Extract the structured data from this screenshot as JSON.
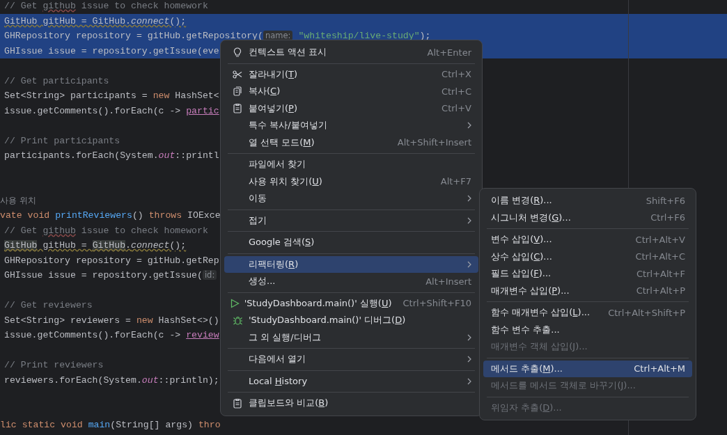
{
  "editor": {
    "lines": [
      {
        "kind": "body",
        "selected": false,
        "segments": [
          {
            "text": "// Get ",
            "kind": "comment"
          },
          {
            "text": "github",
            "kind": "typo"
          },
          {
            "text": " issue to check homework",
            "kind": "comment"
          }
        ]
      },
      {
        "kind": "body",
        "selected": true,
        "segments": [
          {
            "text": "GitHub gitHub = GitHub.",
            "kind": "warning"
          },
          {
            "text": "connect",
            "kind": "warning-italic"
          },
          {
            "text": "();",
            "kind": "warning"
          }
        ]
      },
      {
        "kind": "body",
        "selected": true,
        "segments": [
          {
            "text": "GHRepository repository = gitHub.getRepository(",
            "kind": "plain"
          },
          {
            "text": "name:",
            "kind": "hint"
          },
          {
            "text": "\"whiteship/live-study\"",
            "kind": "string"
          },
          {
            "text": ");",
            "kind": "plain"
          }
        ]
      },
      {
        "kind": "body",
        "selected": true,
        "segments": [
          {
            "text": "GHIssue issue = repository.getIssue(eve",
            "kind": "plain"
          }
        ]
      },
      {
        "kind": "blank",
        "selected": false
      },
      {
        "kind": "body",
        "selected": false,
        "segments": [
          {
            "text": "// Get participants",
            "kind": "comment"
          }
        ]
      },
      {
        "kind": "body",
        "selected": false,
        "segments": [
          {
            "text": "Set<String> participants = ",
            "kind": "plain"
          },
          {
            "text": "new",
            "kind": "keyword"
          },
          {
            "text": " HashSet<",
            "kind": "plain"
          }
        ]
      },
      {
        "kind": "body",
        "selected": false,
        "segments": [
          {
            "text": "issue.getComments().forEach(c -> ",
            "kind": "plain"
          },
          {
            "text": "partic",
            "kind": "field-underline"
          }
        ]
      },
      {
        "kind": "blank",
        "selected": false
      },
      {
        "kind": "body",
        "selected": false,
        "segments": [
          {
            "text": "// Print participants",
            "kind": "comment"
          }
        ]
      },
      {
        "kind": "body",
        "selected": false,
        "segments": [
          {
            "text": "participants.forEach(System.",
            "kind": "plain"
          },
          {
            "text": "out",
            "kind": "static"
          },
          {
            "text": "::printl",
            "kind": "plain"
          }
        ]
      },
      {
        "kind": "blank",
        "selected": false
      },
      {
        "kind": "blank",
        "selected": false
      },
      {
        "kind": "usage-hint",
        "selected": false,
        "segments": [
          {
            "text": "사용 위치",
            "kind": "plain"
          }
        ]
      },
      {
        "kind": "declaration",
        "selected": false,
        "segments": [
          {
            "text": "vate void ",
            "kind": "keyword"
          },
          {
            "text": "printReviewers",
            "kind": "method"
          },
          {
            "text": "() ",
            "kind": "plain"
          },
          {
            "text": "throws",
            "kind": "keyword"
          },
          {
            "text": " IOExce",
            "kind": "plain"
          }
        ]
      },
      {
        "kind": "body",
        "selected": false,
        "segments": [
          {
            "text": "// Get ",
            "kind": "comment"
          },
          {
            "text": "github",
            "kind": "typo"
          },
          {
            "text": " issue to check homework",
            "kind": "comment"
          }
        ]
      },
      {
        "kind": "body",
        "selected": false,
        "segments": [
          {
            "text": "GitHub",
            "kind": "usage"
          },
          {
            "text": " gitHub = ",
            "kind": "warning"
          },
          {
            "text": "GitHub",
            "kind": "usage"
          },
          {
            "text": ".",
            "kind": "warning"
          },
          {
            "text": "connect",
            "kind": "warning-italic"
          },
          {
            "text": "();",
            "kind": "warning"
          }
        ]
      },
      {
        "kind": "body",
        "selected": false,
        "segments": [
          {
            "text": "GHRepository repository = gitHub.getRep",
            "kind": "plain"
          }
        ]
      },
      {
        "kind": "body",
        "selected": false,
        "segments": [
          {
            "text": "GHIssue issue = repository.getIssue(",
            "kind": "plain"
          },
          {
            "text": "id:",
            "kind": "hint"
          }
        ]
      },
      {
        "kind": "blank",
        "selected": false
      },
      {
        "kind": "body",
        "selected": false,
        "segments": [
          {
            "text": "// Get reviewers",
            "kind": "comment"
          }
        ]
      },
      {
        "kind": "body",
        "selected": false,
        "segments": [
          {
            "text": "Set<String> reviewers = ",
            "kind": "plain"
          },
          {
            "text": "new",
            "kind": "keyword"
          },
          {
            "text": " HashSet<>()",
            "kind": "plain"
          }
        ]
      },
      {
        "kind": "body",
        "selected": false,
        "segments": [
          {
            "text": "issue.getComments().forEach(c -> ",
            "kind": "plain"
          },
          {
            "text": "review",
            "kind": "field-underline"
          }
        ]
      },
      {
        "kind": "blank",
        "selected": false
      },
      {
        "kind": "body",
        "selected": false,
        "segments": [
          {
            "text": "// Print reviewers",
            "kind": "comment"
          }
        ]
      },
      {
        "kind": "body",
        "selected": false,
        "segments": [
          {
            "text": "reviewers.forEach(System.",
            "kind": "plain"
          },
          {
            "text": "out",
            "kind": "static"
          },
          {
            "text": "::println);",
            "kind": "plain"
          }
        ]
      },
      {
        "kind": "blank",
        "selected": false
      },
      {
        "kind": "blank",
        "selected": false
      },
      {
        "kind": "declaration",
        "selected": false,
        "segments": [
          {
            "text": "lic static void ",
            "kind": "keyword"
          },
          {
            "text": "main",
            "kind": "method"
          },
          {
            "text": "(String[] args) ",
            "kind": "plain"
          },
          {
            "text": "thro",
            "kind": "keyword"
          }
        ]
      }
    ]
  },
  "context_menu": {
    "items": [
      {
        "kind": "hint",
        "label": "컨텍스트 액션 표시",
        "shortcut": "Alt+Enter",
        "submenu": false,
        "selected": false,
        "disabled": false
      },
      {
        "kind": "separator"
      },
      {
        "kind": "cut",
        "label": "잘라내기(",
        "mnemonic": "T",
        "label_end": ")",
        "shortcut": "Ctrl+X",
        "submenu": false,
        "selected": false,
        "disabled": false
      },
      {
        "kind": "copy",
        "label": "복사(",
        "mnemonic": "C",
        "label_end": ")",
        "shortcut": "Ctrl+C",
        "submenu": false,
        "selected": false,
        "disabled": false
      },
      {
        "kind": "paste",
        "label": "붙여넣기(",
        "mnemonic": "P",
        "label_end": ")",
        "shortcut": "Ctrl+V",
        "submenu": false,
        "selected": false,
        "disabled": false
      },
      {
        "kind": "item",
        "label": "특수 복사/붙여넣기",
        "submenu": true,
        "selected": false,
        "disabled": false
      },
      {
        "kind": "item",
        "label": "열 선택 모드(",
        "mnemonic": "M",
        "label_end": ")",
        "shortcut": "Alt+Shift+Insert",
        "submenu": false,
        "selected": false,
        "disabled": false
      },
      {
        "kind": "separator"
      },
      {
        "kind": "item",
        "label": "파일에서 찾기",
        "submenu": false,
        "selected": false,
        "disabled": false
      },
      {
        "kind": "item",
        "label": "사용 위치 찾기(",
        "mnemonic": "U",
        "label_end": ")",
        "shortcut": "Alt+F7",
        "submenu": false,
        "selected": false,
        "disabled": false
      },
      {
        "kind": "item",
        "label": "이동",
        "submenu": true,
        "selected": false,
        "disabled": false
      },
      {
        "kind": "separator"
      },
      {
        "kind": "item",
        "label": "접기",
        "submenu": true,
        "selected": false,
        "disabled": false
      },
      {
        "kind": "separator"
      },
      {
        "kind": "item",
        "label": "Google 검색(",
        "mnemonic": "S",
        "label_end": ")",
        "submenu": false,
        "selected": false,
        "disabled": false
      },
      {
        "kind": "separator"
      },
      {
        "kind": "item",
        "label": "리팩터링(",
        "mnemonic": "R",
        "label_end": ")",
        "submenu": true,
        "selected": true,
        "disabled": false
      },
      {
        "kind": "item",
        "label": "생성...",
        "shortcut": "Alt+Insert",
        "submenu": false,
        "selected": false,
        "disabled": false
      },
      {
        "kind": "separator"
      },
      {
        "kind": "run",
        "label": "'StudyDashboard.main()' 실행(",
        "mnemonic": "U",
        "label_end": ")",
        "shortcut": "Ctrl+Shift+F10",
        "submenu": false,
        "selected": false,
        "disabled": false
      },
      {
        "kind": "debug",
        "label": "'StudyDashboard.main()' 디버그(",
        "mnemonic": "D",
        "label_end": ")",
        "submenu": false,
        "selected": false,
        "disabled": false
      },
      {
        "kind": "item",
        "label": "그 외 실행/디버그",
        "submenu": true,
        "selected": false,
        "disabled": false
      },
      {
        "kind": "separator"
      },
      {
        "kind": "item",
        "label": "다음에서 열기",
        "submenu": true,
        "selected": false,
        "disabled": false
      },
      {
        "kind": "separator"
      },
      {
        "kind": "item",
        "label": "Local ",
        "mnemonic": "H",
        "label_end": "istory",
        "submenu": true,
        "selected": false,
        "disabled": false
      },
      {
        "kind": "separator"
      },
      {
        "kind": "compare",
        "label": "클립보드와 비교(",
        "mnemonic": "B",
        "label_end": ")",
        "submenu": false,
        "selected": false,
        "disabled": false
      }
    ]
  },
  "refactor_menu": {
    "items": [
      {
        "kind": "item",
        "label": "이름 변경(",
        "mnemonic": "R",
        "label_end": ")...",
        "shortcut": "Shift+F6",
        "submenu": false,
        "selected": false,
        "disabled": false
      },
      {
        "kind": "item",
        "label": "시그니처 변경(",
        "mnemonic": "G",
        "label_end": ")...",
        "shortcut": "Ctrl+F6",
        "submenu": false,
        "selected": false,
        "disabled": false
      },
      {
        "kind": "separator"
      },
      {
        "kind": "item",
        "label": "변수 삽입(",
        "mnemonic": "V",
        "label_end": ")...",
        "shortcut": "Ctrl+Alt+V",
        "submenu": false,
        "selected": false,
        "disabled": false
      },
      {
        "kind": "item",
        "label": "상수 삽입(",
        "mnemonic": "C",
        "label_end": ")...",
        "shortcut": "Ctrl+Alt+C",
        "submenu": false,
        "selected": false,
        "disabled": false
      },
      {
        "kind": "item",
        "label": "필드 삽입(",
        "mnemonic": "F",
        "label_end": ")...",
        "shortcut": "Ctrl+Alt+F",
        "submenu": false,
        "selected": false,
        "disabled": false
      },
      {
        "kind": "item",
        "label": "매개변수 삽입(",
        "mnemonic": "P",
        "label_end": ")...",
        "shortcut": "Ctrl+Alt+P",
        "submenu": false,
        "selected": false,
        "disabled": false
      },
      {
        "kind": "separator"
      },
      {
        "kind": "item",
        "label": "함수 매개변수 삽입(",
        "mnemonic": "L",
        "label_end": ")...",
        "shortcut": "Ctrl+Alt+Shift+P",
        "submenu": false,
        "selected": false,
        "disabled": false
      },
      {
        "kind": "item",
        "label": "함수 변수 추출...",
        "submenu": false,
        "selected": false,
        "disabled": false
      },
      {
        "kind": "item",
        "label": "매개변수 객체 삽입(",
        "mnemonic": "J",
        "label_end": ")...",
        "submenu": false,
        "selected": false,
        "disabled": true
      },
      {
        "kind": "separator"
      },
      {
        "kind": "item",
        "label": "메서드 추출(",
        "mnemonic": "M",
        "label_end": ")...",
        "shortcut": "Ctrl+Alt+M",
        "submenu": false,
        "selected": true,
        "disabled": false
      },
      {
        "kind": "item",
        "label": "메서드를 메서드 객체로 바꾸기(",
        "mnemonic": "J",
        "label_end": ")...",
        "submenu": false,
        "selected": false,
        "disabled": true
      },
      {
        "kind": "separator"
      },
      {
        "kind": "item",
        "label": "위임자 추출(",
        "mnemonic": "D",
        "label_end": ")...",
        "submenu": false,
        "selected": false,
        "disabled": true
      }
    ]
  }
}
